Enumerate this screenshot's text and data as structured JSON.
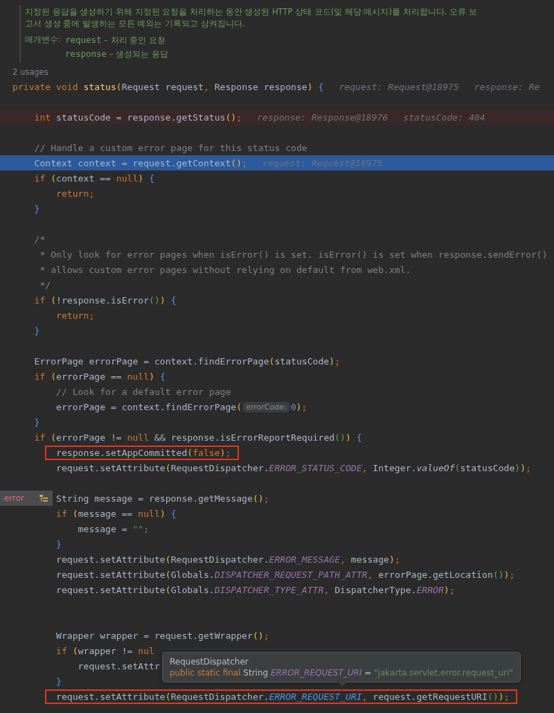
{
  "doc": {
    "summary": "지정된 응답을 생성하기 위해 지정된 요청을 처리하는 동안 생성된 HTTP 상태 코드(및 해당 메시지)를 처리합니다. 오류 보고서 생성 중에 발생하는 모든 예외는 기록되고 삼켜집니다.",
    "params_label": "매개변수:",
    "params": [
      {
        "name": "request",
        "description": "– 처리 중인 요청"
      },
      {
        "name": "response",
        "description": "– 생성되는 응답"
      }
    ]
  },
  "usages": "2 usages",
  "lines": [
    {
      "kind": "normal",
      "boxed": false,
      "tokens": [
        {
          "kind": "kw",
          "text": "private void "
        },
        {
          "kind": "fn",
          "text": "status"
        },
        {
          "kind": "paren",
          "text": "("
        },
        {
          "kind": "plain",
          "text": "Request request"
        },
        {
          "kind": "kw",
          "text": ","
        },
        {
          "kind": "plain",
          "text": " Response response"
        },
        {
          "kind": "paren",
          "text": ")"
        },
        {
          "kind": "brace",
          "text": " {"
        },
        {
          "kind": "hint",
          "text": "request: Request@18975"
        },
        {
          "kind": "hint",
          "text": "response: Re"
        }
      ]
    },
    {
      "kind": "normal",
      "boxed": false
    },
    {
      "kind": "breakpoint",
      "boxed": false,
      "tokens": [
        {
          "kind": "kw",
          "text": "    int"
        },
        {
          "kind": "plain",
          "text": " statusCode = response.getStatus"
        },
        {
          "kind": "paren",
          "text": "()"
        },
        {
          "kind": "kw",
          "text": ";"
        },
        {
          "kind": "hint",
          "text": "response: Response@18976"
        },
        {
          "kind": "hint",
          "text": "statusCode: 404"
        }
      ]
    },
    {
      "kind": "normal",
      "boxed": false
    },
    {
      "kind": "normal",
      "boxed": false,
      "tokens": [
        {
          "kind": "comment",
          "text": "    // Handle a custom error page for this status code"
        }
      ]
    },
    {
      "kind": "current",
      "boxed": false,
      "tokens": [
        {
          "kind": "plain",
          "text": "    Context context = request.getContext"
        },
        {
          "kind": "paren",
          "text": "()"
        },
        {
          "kind": "kw",
          "text": ";"
        },
        {
          "kind": "hint",
          "text": "request: Request@18975"
        }
      ]
    },
    {
      "kind": "normal",
      "boxed": false,
      "tokens": [
        {
          "kind": "kw",
          "text": "    if "
        },
        {
          "kind": "paren",
          "text": "("
        },
        {
          "kind": "plain",
          "text": "context == "
        },
        {
          "kind": "kw",
          "text": "null"
        },
        {
          "kind": "paren",
          "text": ")"
        },
        {
          "kind": "brace",
          "text": " {"
        }
      ]
    },
    {
      "kind": "normal",
      "boxed": false,
      "tokens": [
        {
          "kind": "kw",
          "text": "        return;"
        }
      ]
    },
    {
      "kind": "normal",
      "boxed": false,
      "tokens": [
        {
          "kind": "brace",
          "text": "    }"
        }
      ]
    },
    {
      "kind": "normal",
      "boxed": false
    },
    {
      "kind": "normal",
      "boxed": false,
      "tokens": [
        {
          "kind": "comment",
          "text": "    /*"
        }
      ]
    },
    {
      "kind": "normal",
      "boxed": false,
      "tokens": [
        {
          "kind": "comment",
          "text": "     * Only look for error pages when isError() is set. isError() is set when response.sendError()"
        }
      ]
    },
    {
      "kind": "normal",
      "boxed": false,
      "tokens": [
        {
          "kind": "comment",
          "text": "     * allows custom error pages without relying on default from web.xml."
        }
      ]
    },
    {
      "kind": "normal",
      "boxed": false,
      "tokens": [
        {
          "kind": "comment",
          "text": "     */"
        }
      ]
    },
    {
      "kind": "normal",
      "boxed": false,
      "tokens": [
        {
          "kind": "kw",
          "text": "    if "
        },
        {
          "kind": "paren",
          "text": "("
        },
        {
          "kind": "plain",
          "text": "!response.isError"
        },
        {
          "kind": "paren2",
          "text": "()"
        },
        {
          "kind": "paren",
          "text": ")"
        },
        {
          "kind": "brace",
          "text": " {"
        }
      ]
    },
    {
      "kind": "normal",
      "boxed": false,
      "tokens": [
        {
          "kind": "kw",
          "text": "        return;"
        }
      ]
    },
    {
      "kind": "normal",
      "boxed": false,
      "tokens": [
        {
          "kind": "brace",
          "text": "    }"
        }
      ]
    },
    {
      "kind": "normal",
      "boxed": false
    },
    {
      "kind": "normal",
      "boxed": false,
      "tokens": [
        {
          "kind": "plain",
          "text": "    ErrorPage errorPage = context.findErrorPage"
        },
        {
          "kind": "paren",
          "text": "("
        },
        {
          "kind": "plain",
          "text": "statusCode"
        },
        {
          "kind": "paren",
          "text": ")"
        },
        {
          "kind": "kw",
          "text": ";"
        }
      ]
    },
    {
      "kind": "normal",
      "boxed": false,
      "tokens": [
        {
          "kind": "kw",
          "text": "    if "
        },
        {
          "kind": "paren",
          "text": "("
        },
        {
          "kind": "plain",
          "text": "errorPage == "
        },
        {
          "kind": "kw",
          "text": "null"
        },
        {
          "kind": "paren",
          "text": ")"
        },
        {
          "kind": "brace",
          "text": " {"
        }
      ]
    },
    {
      "kind": "normal",
      "boxed": false,
      "tokens": [
        {
          "kind": "comment",
          "text": "        // Look for a default error page"
        }
      ]
    },
    {
      "kind": "normal",
      "boxed": false,
      "tokens": [
        {
          "kind": "plain",
          "text": "        errorPage = context.findErrorPage"
        },
        {
          "kind": "paren",
          "text": "("
        },
        {
          "kind": "pill",
          "text": "errorCode:"
        },
        {
          "kind": "num",
          "text": "0"
        },
        {
          "kind": "paren",
          "text": ")"
        },
        {
          "kind": "kw",
          "text": ";"
        }
      ]
    },
    {
      "kind": "normal",
      "boxed": false,
      "tokens": [
        {
          "kind": "brace",
          "text": "    }"
        }
      ]
    },
    {
      "kind": "normal",
      "boxed": false,
      "tokens": [
        {
          "kind": "kw",
          "text": "    if "
        },
        {
          "kind": "paren",
          "text": "("
        },
        {
          "kind": "plain",
          "text": "errorPage != "
        },
        {
          "kind": "kw",
          "text": "null"
        },
        {
          "kind": "plain",
          "text": " && response.isErrorReportRequired"
        },
        {
          "kind": "paren2",
          "text": "()"
        },
        {
          "kind": "paren",
          "text": ")"
        },
        {
          "kind": "brace",
          "text": " {"
        }
      ]
    },
    {
      "kind": "normal",
      "boxed": true,
      "tokens": [
        {
          "kind": "plain",
          "text": "        response.setAppCommitted"
        },
        {
          "kind": "paren",
          "text": "("
        },
        {
          "kind": "kw",
          "text": "false"
        },
        {
          "kind": "paren",
          "text": ")"
        },
        {
          "kind": "kw",
          "text": ";"
        }
      ]
    },
    {
      "kind": "normal",
      "boxed": false,
      "tokens": [
        {
          "kind": "plain",
          "text": "        request.setAttribute"
        },
        {
          "kind": "paren",
          "text": "("
        },
        {
          "kind": "plain",
          "text": "RequestDispatcher."
        },
        {
          "kind": "const",
          "text": "ERROR_STATUS_CODE"
        },
        {
          "kind": "kw",
          "text": ","
        },
        {
          "kind": "plain",
          "text": " Integer."
        },
        {
          "kind": "italic",
          "text": "valueOf"
        },
        {
          "kind": "paren2",
          "text": "("
        },
        {
          "kind": "plain",
          "text": "statusCode"
        },
        {
          "kind": "paren2",
          "text": ")"
        },
        {
          "kind": "paren",
          "text": ")"
        },
        {
          "kind": "kw",
          "text": ";"
        }
      ]
    },
    {
      "kind": "normal",
      "boxed": false
    },
    {
      "kind": "normal",
      "boxed": false,
      "tokens": [
        {
          "kind": "plain",
          "text": "        String message = response.getMessage"
        },
        {
          "kind": "paren",
          "text": "()"
        },
        {
          "kind": "kw",
          "text": ";"
        }
      ]
    },
    {
      "kind": "normal",
      "boxed": false,
      "tokens": [
        {
          "kind": "kw",
          "text": "        if "
        },
        {
          "kind": "paren",
          "text": "("
        },
        {
          "kind": "plain",
          "text": "message == "
        },
        {
          "kind": "kw",
          "text": "null"
        },
        {
          "kind": "paren",
          "text": ")"
        },
        {
          "kind": "brace",
          "text": " {"
        }
      ]
    },
    {
      "kind": "normal",
      "boxed": false,
      "tokens": [
        {
          "kind": "plain",
          "text": "            message = "
        },
        {
          "kind": "str",
          "text": "\"\""
        },
        {
          "kind": "kw",
          "text": ";"
        }
      ]
    },
    {
      "kind": "normal",
      "boxed": false,
      "tokens": [
        {
          "kind": "brace",
          "text": "        }"
        }
      ]
    },
    {
      "kind": "normal",
      "boxed": false,
      "tokens": [
        {
          "kind": "plain",
          "text": "        request.setAttribute"
        },
        {
          "kind": "paren",
          "text": "("
        },
        {
          "kind": "plain",
          "text": "RequestDispatcher."
        },
        {
          "kind": "const",
          "text": "ERROR_MESSAGE"
        },
        {
          "kind": "kw",
          "text": ","
        },
        {
          "kind": "plain",
          "text": " message"
        },
        {
          "kind": "paren",
          "text": ")"
        },
        {
          "kind": "kw",
          "text": ";"
        }
      ]
    },
    {
      "kind": "normal",
      "boxed": false,
      "tokens": [
        {
          "kind": "plain",
          "text": "        request.setAttribute"
        },
        {
          "kind": "paren",
          "text": "("
        },
        {
          "kind": "plain",
          "text": "Globals."
        },
        {
          "kind": "const",
          "text": "DISPATCHER_REQUEST_PATH_ATTR"
        },
        {
          "kind": "kw",
          "text": ","
        },
        {
          "kind": "plain",
          "text": " errorPage.getLocation"
        },
        {
          "kind": "paren2",
          "text": "()"
        },
        {
          "kind": "paren",
          "text": ")"
        },
        {
          "kind": "kw",
          "text": ";"
        }
      ]
    },
    {
      "kind": "normal",
      "boxed": false,
      "tokens": [
        {
          "kind": "plain",
          "text": "        request.setAttribute"
        },
        {
          "kind": "paren",
          "text": "("
        },
        {
          "kind": "plain",
          "text": "Globals."
        },
        {
          "kind": "const",
          "text": "DISPATCHER_TYPE_ATTR"
        },
        {
          "kind": "kw",
          "text": ","
        },
        {
          "kind": "plain",
          "text": " DispatcherType."
        },
        {
          "kind": "const",
          "text": "ERROR"
        },
        {
          "kind": "paren",
          "text": ")"
        },
        {
          "kind": "kw",
          "text": ";"
        }
      ]
    },
    {
      "kind": "normal",
      "boxed": false
    },
    {
      "kind": "normal",
      "boxed": false
    },
    {
      "kind": "normal",
      "boxed": false,
      "tokens": [
        {
          "kind": "plain",
          "text": "        Wrapper wrapper = request.getWrapper"
        },
        {
          "kind": "paren",
          "text": "()"
        },
        {
          "kind": "kw",
          "text": ";"
        }
      ]
    },
    {
      "kind": "normal",
      "boxed": false,
      "tokens": [
        {
          "kind": "kw",
          "text": "        if "
        },
        {
          "kind": "paren",
          "text": "("
        },
        {
          "kind": "plain",
          "text": "wrapper != "
        },
        {
          "kind": "kw",
          "text": "nul"
        }
      ]
    },
    {
      "kind": "normal",
      "boxed": false,
      "tokens": [
        {
          "kind": "plain",
          "text": "            request.setAttr"
        }
      ]
    },
    {
      "kind": "normal",
      "boxed": false,
      "tokens": [
        {
          "kind": "brace",
          "text": "        }"
        }
      ]
    },
    {
      "kind": "normal",
      "boxed": true,
      "tokens": [
        {
          "kind": "plain",
          "text": "        request.setAttribute"
        },
        {
          "kind": "paren",
          "text": "("
        },
        {
          "kind": "plain",
          "text": "RequestDispatcher."
        },
        {
          "kind": "link",
          "text": "ERROR_REQUEST_URI"
        },
        {
          "kind": "kw",
          "text": ","
        },
        {
          "kind": "plain",
          "text": " request.getRequestURI"
        },
        {
          "kind": "paren2",
          "text": "()"
        },
        {
          "kind": "paren",
          "text": ")"
        },
        {
          "kind": "kw",
          "text": ";"
        }
      ]
    }
  ],
  "gutter_marker": {
    "label": "error"
  },
  "tooltip": {
    "title": "RequestDispatcher",
    "tokens": [
      {
        "kind": "kw",
        "text": "public static final "
      },
      {
        "kind": "plain",
        "text": "String "
      },
      {
        "kind": "const",
        "text": "ERROR_REQUEST_URI"
      },
      {
        "kind": "plain",
        "text": " = "
      },
      {
        "kind": "str",
        "text": "\"jakarta.servlet.error.request_uri\""
      }
    ]
  }
}
